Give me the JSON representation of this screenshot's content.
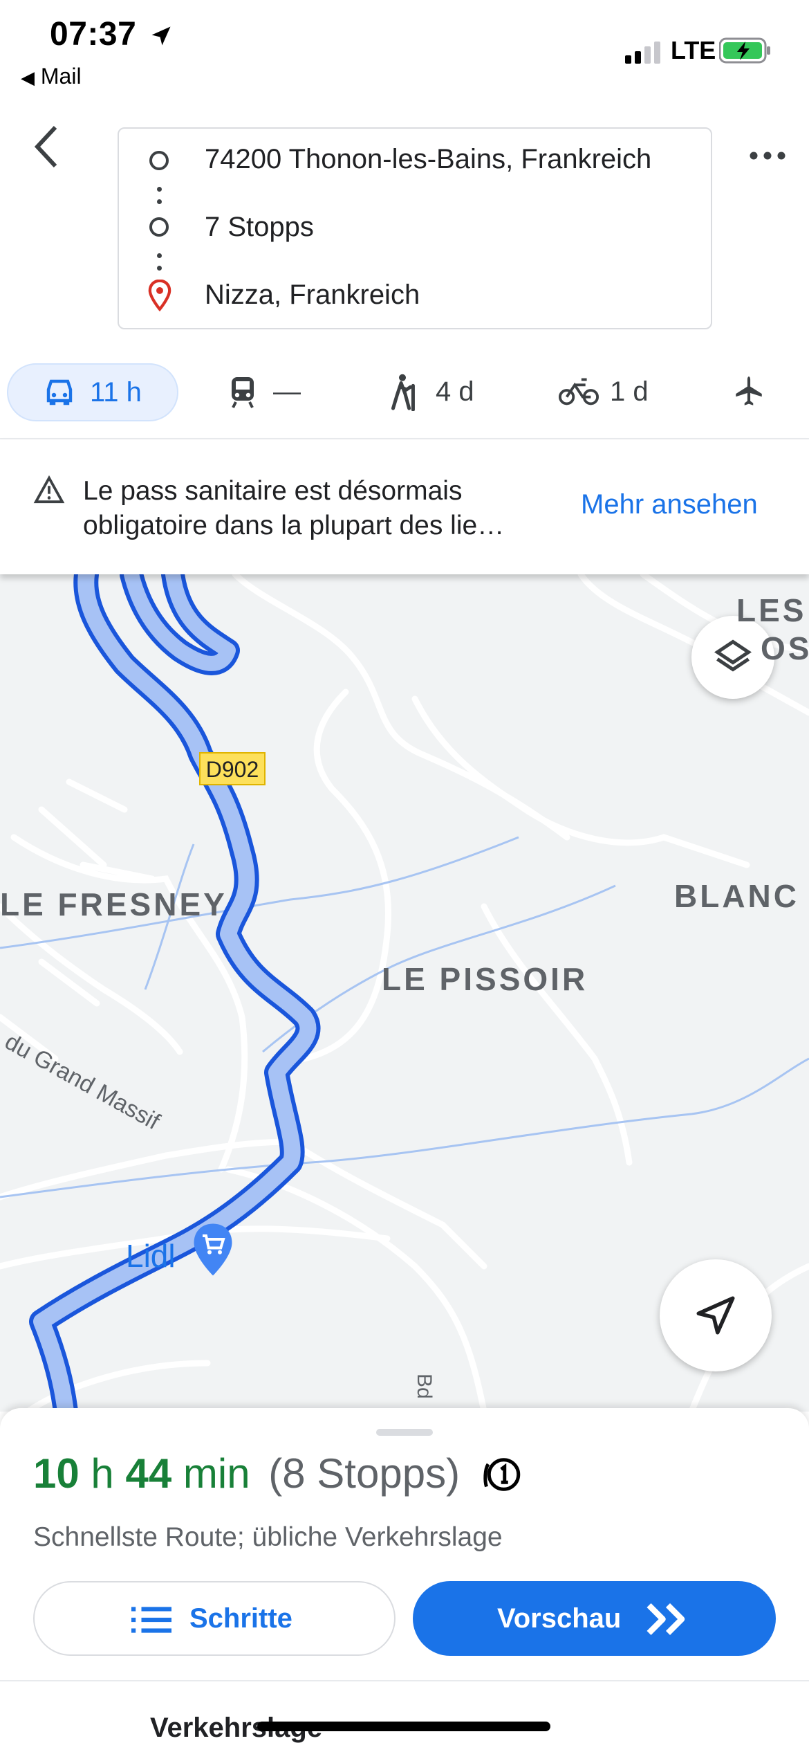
{
  "status_bar": {
    "time": "07:37",
    "back_app": "Mail",
    "network": "LTE"
  },
  "route": {
    "origin": "74200 Thonon-les-Bains, Frankreich",
    "stops": "7 Stopps",
    "destination": "Nizza, Frankreich"
  },
  "modes": [
    {
      "name": "car",
      "label": "11 h",
      "selected": true
    },
    {
      "name": "transit",
      "label": "—"
    },
    {
      "name": "walk",
      "label": "4 d"
    },
    {
      "name": "bike",
      "label": "1 d"
    },
    {
      "name": "flight",
      "label": ""
    }
  ],
  "notice": {
    "line1": "Le pass sanitaire est désormais",
    "line2": "obligatoire dans la plupart des lie…",
    "link": "Mehr ansehen"
  },
  "map": {
    "labels": [
      "LE FRESNEY",
      "LE PISSOIR",
      "BLANC",
      "LES",
      "OS"
    ],
    "road_badge": "D902",
    "street": "v. du Grand Massif",
    "street2": "Bd",
    "poi": "Lidl",
    "route_color": "#4285f4"
  },
  "summary": {
    "hours": "10",
    "h_unit": "h",
    "minutes": "44",
    "min_unit": "min",
    "stops": "(8 Stopps)",
    "description": "Schnellste Route; übliche Verkehrslage",
    "steps_label": "Schritte",
    "preview_label": "Vorschau",
    "traffic_label": "Verkehrslage"
  },
  "colors": {
    "accent": "#1a73e8",
    "duration": "#188038",
    "warning": "#3c4043"
  }
}
